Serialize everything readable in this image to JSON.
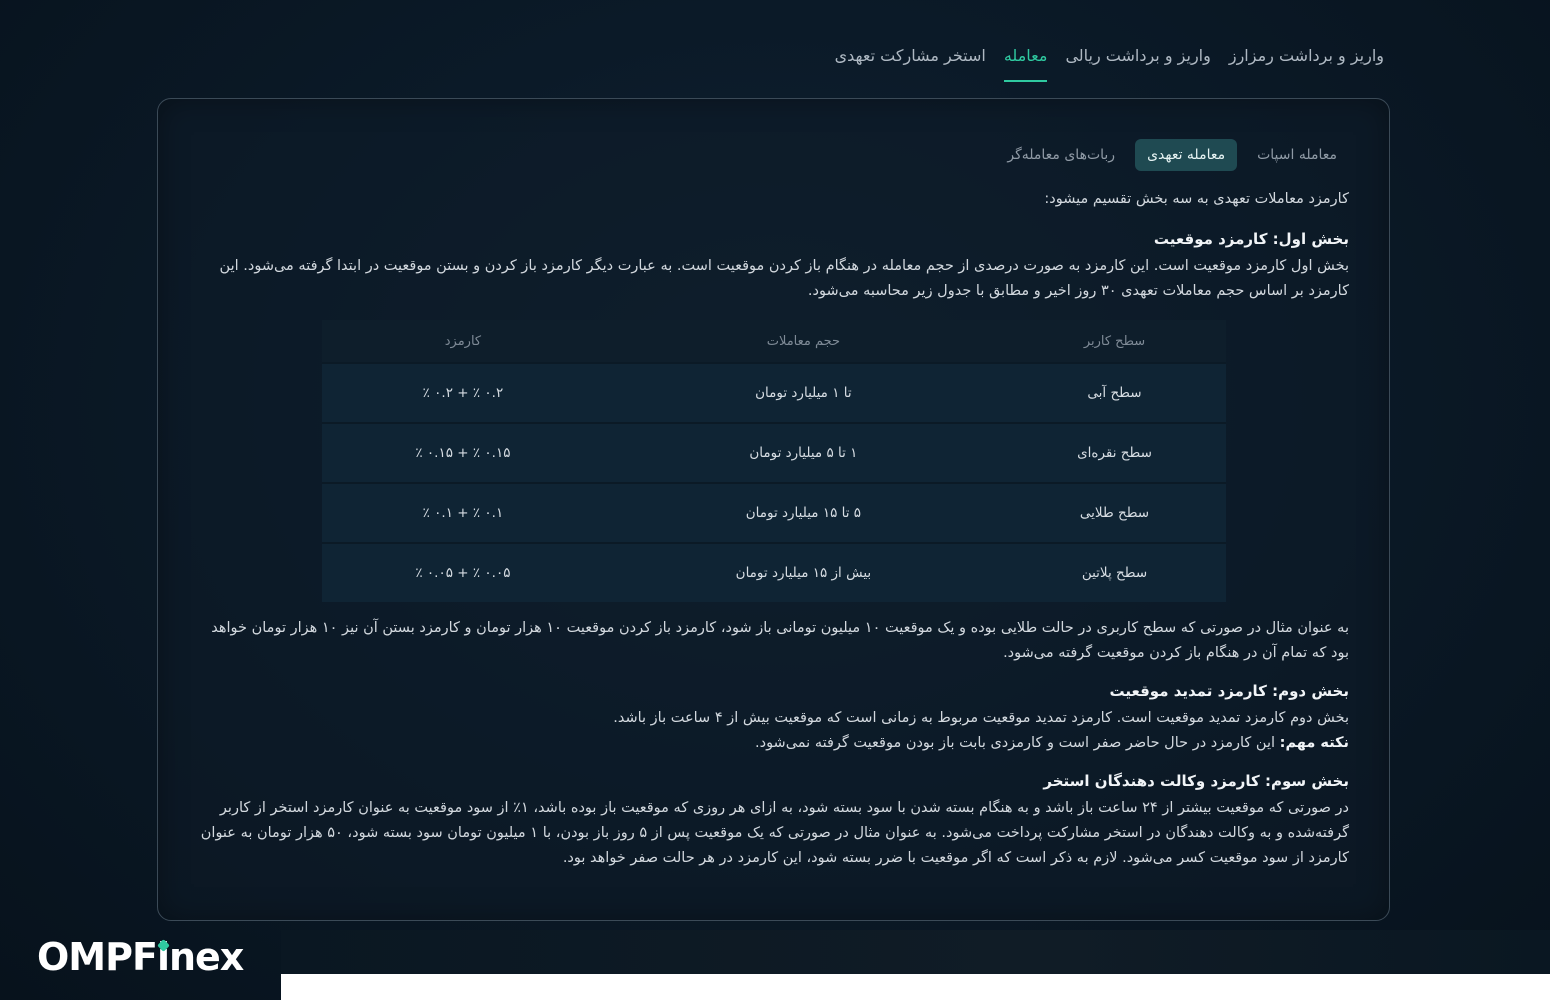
{
  "top_tabs": [
    {
      "label": "استخر مشارکت تعهدی",
      "active": false
    },
    {
      "label": "معامله",
      "active": true
    },
    {
      "label": "واریز و برداشت ریالی",
      "active": false
    },
    {
      "label": "واریز و برداشت رمزارز",
      "active": false
    }
  ],
  "sub_tabs": [
    {
      "label": "معامله اسپات",
      "active": false
    },
    {
      "label": "معامله تعهدی",
      "active": true
    },
    {
      "label": "ربات‌های معامله‌گر",
      "active": false
    }
  ],
  "content": {
    "intro": "کارمزد معاملات تعهدی به سه بخش تقسیم میشود:",
    "section1_title": "بخش اول: کارمزد موقعیت",
    "section1_text": "بخش اول کارمزد موقعیت است. این کارمزد به صورت درصدی از حجم معامله در هنگام باز کردن موقعیت است. به عبارت دیگر کارمزد باز کردن و بستن موقعیت در ابتدا گرفته می‌شود. این کارمزد بر اساس حجم معاملات تعهدی ۳۰ روز اخیر و مطابق با جدول زیر محاسبه می‌شود.",
    "table": {
      "headers": [
        "سطح کاربر",
        "حجم معاملات",
        "کارمزد"
      ],
      "rows": [
        [
          "سطح آبی",
          "تا ۱ میلیارد تومان",
          "٪ ۰.۲ + ٪ ۰.۲"
        ],
        [
          "سطح نقره‌ای",
          "۱ تا ۵ میلیارد تومان",
          "٪ ۰.۱۵ + ٪ ۰.۱۵"
        ],
        [
          "سطح طلایی",
          "۵ تا ۱۵ میلیارد تومان",
          "٪ ۰.۱ + ٪ ۰.۱"
        ],
        [
          "سطح پلاتین",
          "بیش از ۱۵ میلیارد تومان",
          "٪ ۰.۰۵ + ٪ ۰.۰۵"
        ]
      ]
    },
    "example_text": "به عنوان مثال در صورتی که سطح کاربری در حالت طلایی بوده و یک موقعیت ۱۰ میلیون تومانی باز شود، کارمزد باز کردن موقعیت ۱۰ هزار تومان و کارمزد بستن آن نیز ۱۰ هزار تومان خواهد بود که تمام آن در هنگام باز کردن موقعیت گرفته می‌شود.",
    "section2_title": "بخش دوم: کارمزد تمدید موقعیت",
    "section2_text": "بخش دوم کارمزد تمدید موقعیت است. کارمزد تمدید موقعیت مربوط به زمانی است که موقعیت بیش از ۴ ساعت باز باشد.",
    "note_label": "نکته مهم:",
    "note_text": " این کارمزد در حال حاضر صفر است و کارمزدی بابت باز بودن موقعیت گرفته نمی‌شود.",
    "section3_title": "بخش سوم: کارمزد وکالت دهندگان استخر",
    "section3_text": "در صورتی که موقعیت بیشتر از ۲۴ ساعت باز باشد و به هنگام بسته شدن با سود بسته شود، به ازای هر روزی که موقعیت باز بوده باشد، ۱٪ از سود موقعیت به عنوان کارمزد استخر از کاربر گرفته‌شده و به وکالت دهندگان در استخر مشارکت پرداخت می‌شود. به عنوان مثال در صورتی که یک موقعیت پس از ۵ روز باز بودن، با ۱ میلیون تومان سود بسته شود، ۵۰ هزار تومان به عنوان کارمزد از سود موقعیت کسر می‌شود. لازم به ذکر است که اگر موقعیت با ضرر بسته شود، این کارمزد در هر حالت صفر خواهد بود."
  },
  "logo": {
    "part1": "OMPF",
    "part2": "i",
    "part3": "nex"
  },
  "colors": {
    "accent": "#2fc9a0",
    "active_subtab_bg": "#1f4a52",
    "background": "#0b1a28"
  }
}
